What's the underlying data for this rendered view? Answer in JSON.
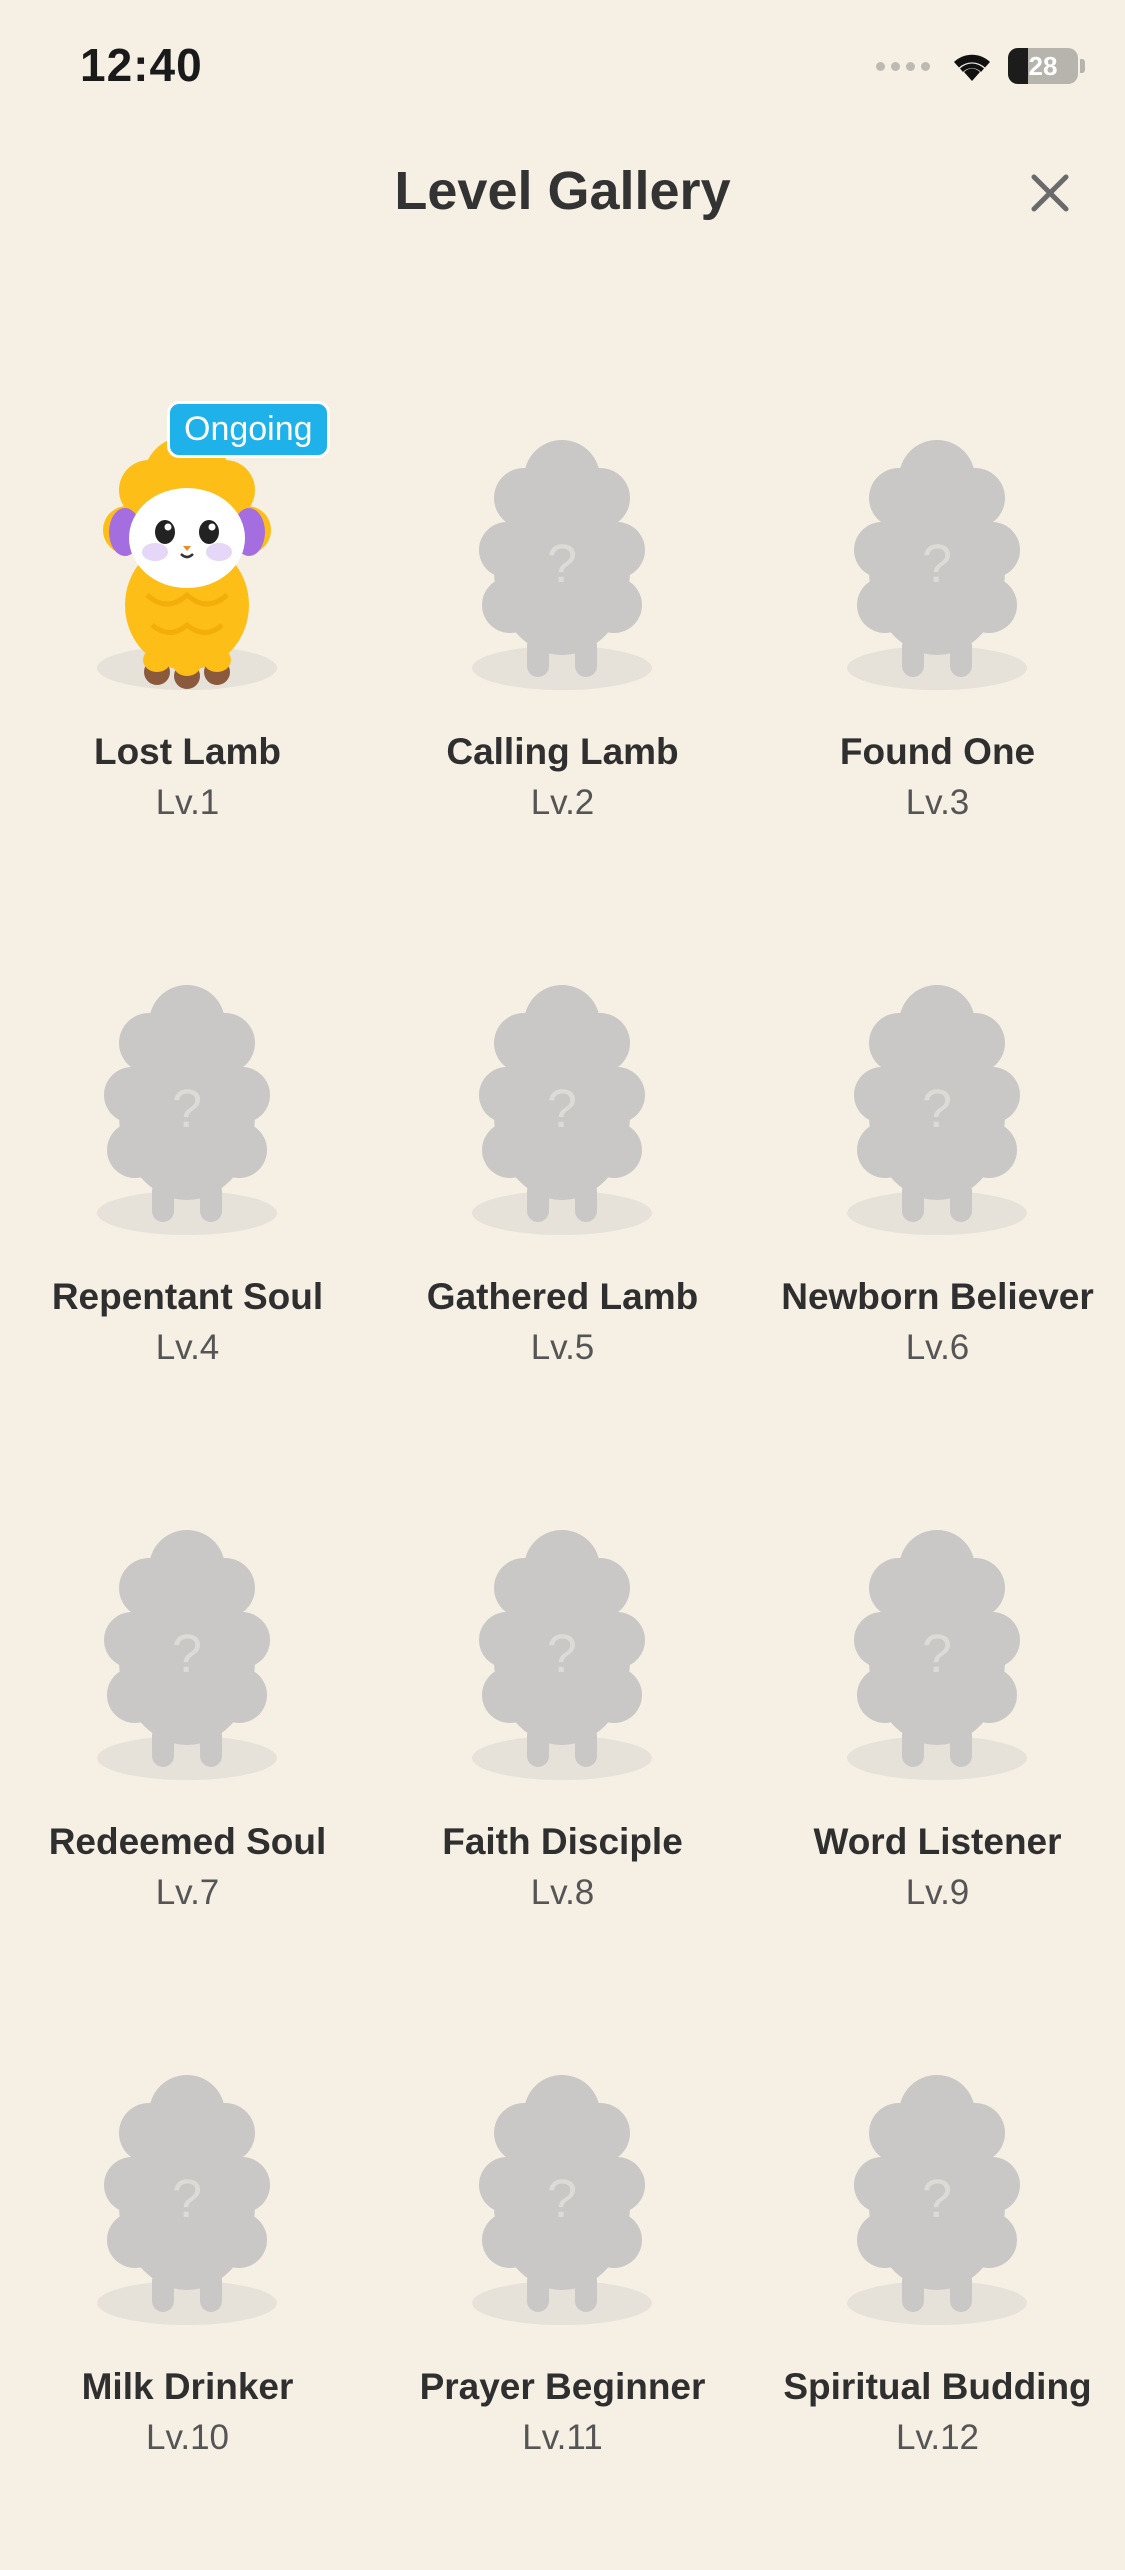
{
  "status": {
    "time": "12:40",
    "battery": "28",
    "battery_level": 0.28
  },
  "header": {
    "title": "Level Gallery",
    "close_icon": "close-icon"
  },
  "gallery": {
    "items": [
      {
        "name": "Lost Lamb",
        "level": "Lv.1",
        "badge": "Ongoing",
        "unlocked": true
      },
      {
        "name": "Calling Lamb",
        "level": "Lv.2",
        "unlocked": false
      },
      {
        "name": "Found One",
        "level": "Lv.3",
        "unlocked": false
      },
      {
        "name": "Repentant Soul",
        "level": "Lv.4",
        "unlocked": false
      },
      {
        "name": "Gathered Lamb",
        "level": "Lv.5",
        "unlocked": false
      },
      {
        "name": "Newborn Believer",
        "level": "Lv.6",
        "unlocked": false
      },
      {
        "name": "Redeemed Soul",
        "level": "Lv.7",
        "unlocked": false
      },
      {
        "name": "Faith Disciple",
        "level": "Lv.8",
        "unlocked": false
      },
      {
        "name": "Word Listener",
        "level": "Lv.9",
        "unlocked": false
      },
      {
        "name": "Milk Drinker",
        "level": "Lv.10",
        "unlocked": false
      },
      {
        "name": "Prayer Beginner",
        "level": "Lv.11",
        "unlocked": false
      },
      {
        "name": "Spiritual Budding",
        "level": "Lv.12",
        "unlocked": false
      }
    ]
  },
  "colors": {
    "background": "#f5efe4",
    "badge": "#1fb1ea",
    "locked_sheep": "#c9c8c6",
    "lamb_wool": "#fdbf17"
  }
}
